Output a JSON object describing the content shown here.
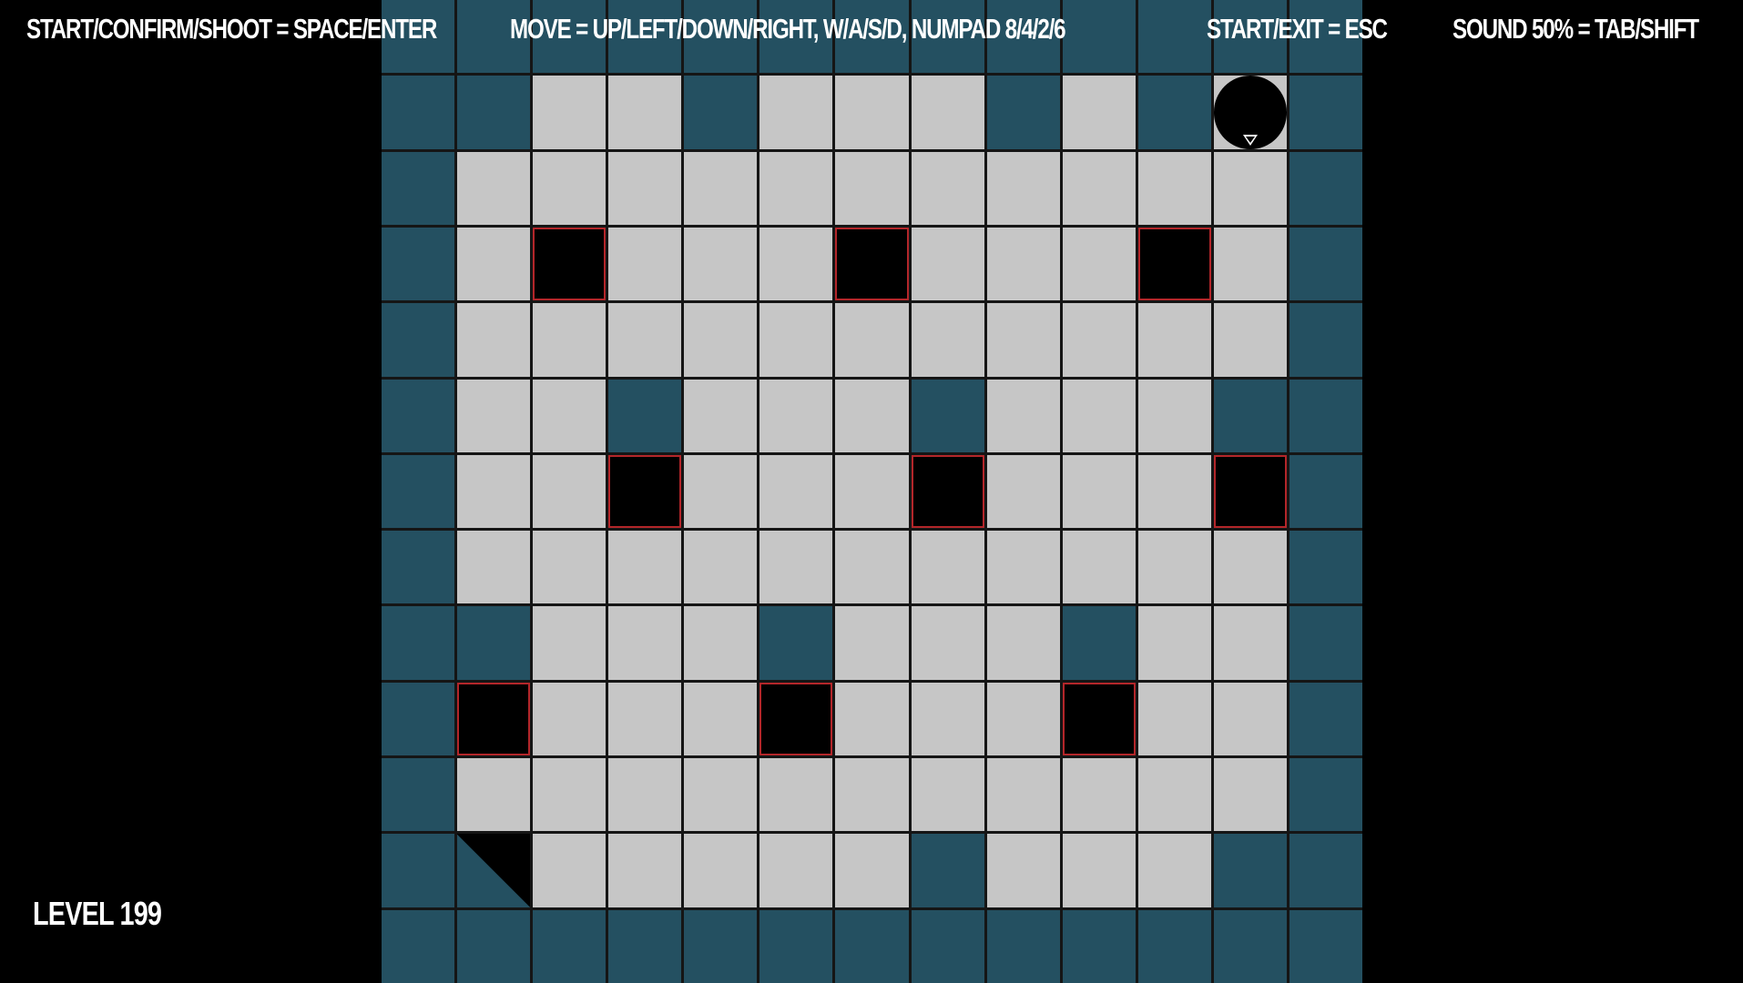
{
  "hud": {
    "start_confirm_shoot": "START/CONFIRM/SHOOT = SPACE/ENTER",
    "move": "MOVE = UP/LEFT/DOWN/RIGHT, W/A/S/D, NUMPAD 8/4/2/6",
    "start_exit": "START/EXIT = ESC",
    "sound": "SOUND 50% = TAB/SHIFT"
  },
  "level_label": "LEVEL 199",
  "colors": {
    "wall": "#245061",
    "floor": "#c6c6c6",
    "pit": "#000000",
    "pit_border": "#b3262a",
    "background": "#000000"
  },
  "board": {
    "cols": 13,
    "rows": 13,
    "legend": {
      "W": "wall",
      "F": "floor",
      "P": "pit",
      "R": "ramp",
      "B": "player"
    },
    "grid": [
      "WWWWWWWWWWWWW",
      "WWFFWFFFWFWBW",
      "WFFFFFFFFFFFW",
      "WFPFFFPFFFPFW",
      "WFFFFFFFFFFFW",
      "WFFWFFFWFFFWW",
      "WFFPFFFPFFFPW",
      "WFFFFFFFFFFFW",
      "WWFFFWFFFWFFW",
      "WPFFFPFFFPFFW",
      "WFFFFFFFFFFFW",
      "WRFFFFFWFFFWW",
      "WWWWWWWWWWWWW"
    ]
  },
  "player": {
    "facing": "down",
    "icon": "ball-player-icon"
  }
}
